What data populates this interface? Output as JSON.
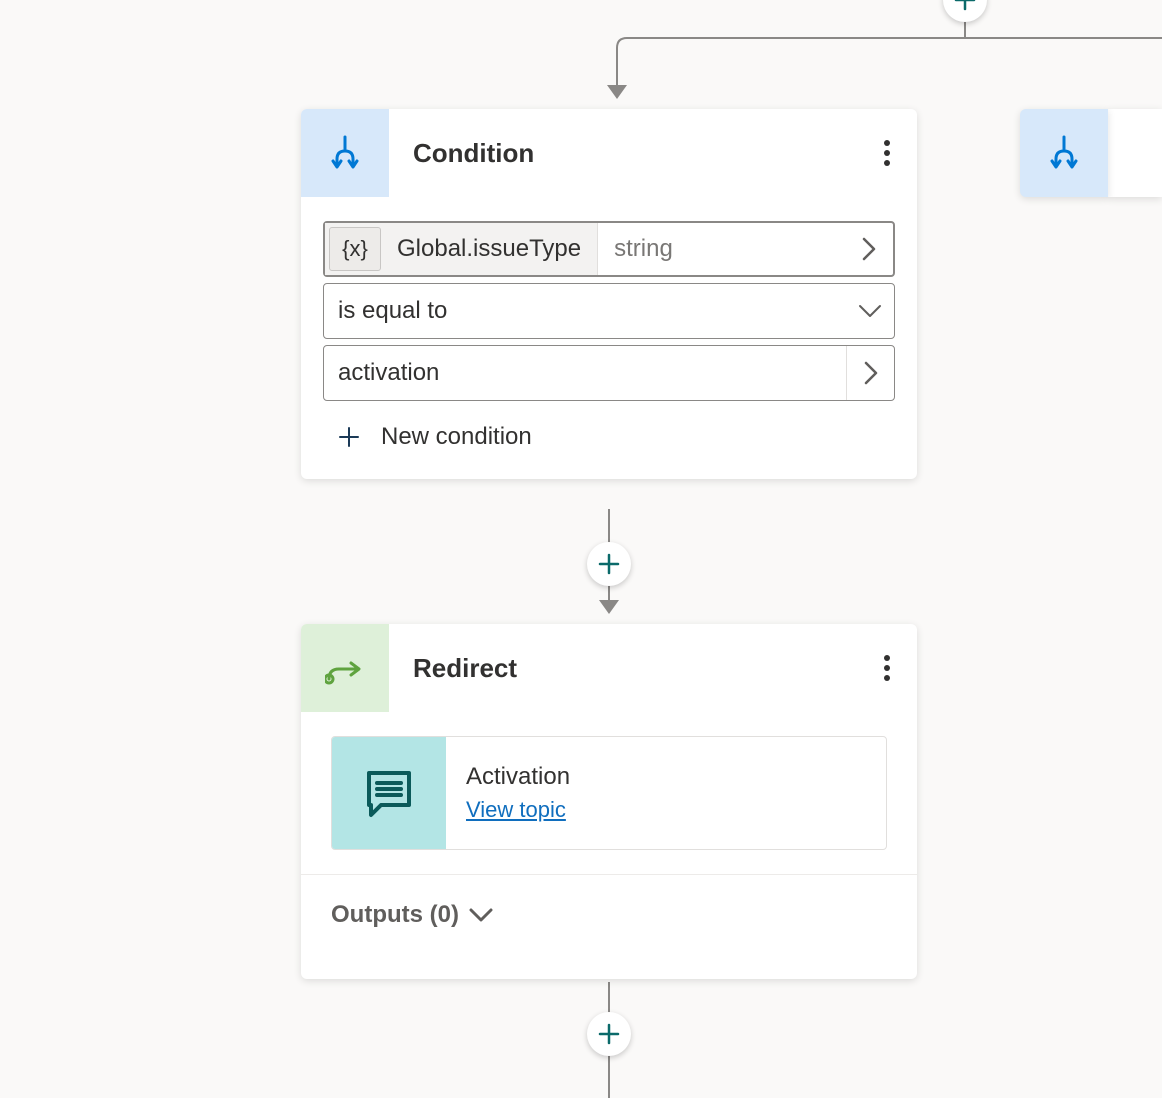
{
  "condition_card": {
    "title": "Condition",
    "variable_token": "{x}",
    "variable_name": "Global.issueType",
    "variable_type": "string",
    "operator": "is equal to",
    "value": "activation",
    "new_condition_label": "New condition"
  },
  "redirect_card": {
    "title": "Redirect",
    "topic_name": "Activation",
    "view_topic": "View topic",
    "outputs_label": "Outputs (0)"
  }
}
